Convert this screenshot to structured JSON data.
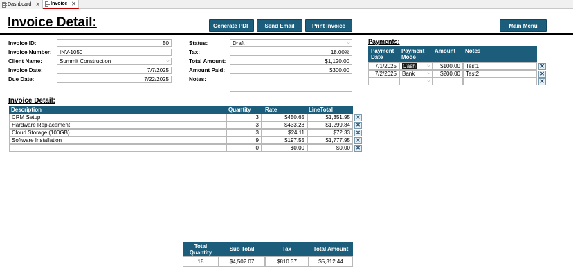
{
  "tabs": [
    {
      "label": "Dashboard",
      "active": false
    },
    {
      "label": "Invoice",
      "active": true
    }
  ],
  "title": "Invoice Detail:",
  "buttons": {
    "generate_pdf": "Generate PDF",
    "send_email": "Send Email",
    "print_invoice": "Print Invoice",
    "main_menu": "Main Menu"
  },
  "fields_left": {
    "invoice_id": {
      "label": "Invoice ID:",
      "value": "50"
    },
    "invoice_number": {
      "label": "Invoice Number:",
      "value": "INV-1050"
    },
    "client_name": {
      "label": "Client Name:",
      "value": "Summit Construction"
    },
    "invoice_date": {
      "label": "Invoice Date:",
      "value": "7/7/2025"
    },
    "due_date": {
      "label": "Due Date:",
      "value": "7/22/2025"
    }
  },
  "fields_mid": {
    "status": {
      "label": "Status:",
      "value": "Draft"
    },
    "tax": {
      "label": "Tax:",
      "value": "18.00%"
    },
    "total_amount": {
      "label": "Total Amount:",
      "value": "$1,120.00"
    },
    "amount_paid": {
      "label": "Amount Paid:",
      "value": "$300.00"
    },
    "notes": {
      "label": "Notes:",
      "value": ""
    }
  },
  "payments": {
    "title": "Payments:",
    "headers": {
      "date": "Payment Date",
      "mode": "Payment Mode",
      "amount": "Amount",
      "notes": "Notes"
    },
    "rows": [
      {
        "date": "7/1/2025",
        "mode": "Cash",
        "amount": "$100.00",
        "notes": "Test1"
      },
      {
        "date": "7/2/2025",
        "mode": "Bank",
        "amount": "$200.00",
        "notes": "Test2"
      },
      {
        "date": "",
        "mode": "",
        "amount": "",
        "notes": ""
      }
    ]
  },
  "detail": {
    "title": "Invoice Detail:",
    "headers": {
      "description": "Description",
      "quantity": "Quantity",
      "rate": "Rate",
      "line_total": "LineTotal"
    },
    "rows": [
      {
        "description": "CRM Setup",
        "quantity": "3",
        "rate": "$450.65",
        "line_total": "$1,351.95"
      },
      {
        "description": "Hardware Replacement",
        "quantity": "3",
        "rate": "$433.28",
        "line_total": "$1,299.84"
      },
      {
        "description": "Cloud Storage (100GB)",
        "quantity": "3",
        "rate": "$24.11",
        "line_total": "$72.33"
      },
      {
        "description": "Software Installation",
        "quantity": "9",
        "rate": "$197.55",
        "line_total": "$1,777.95"
      },
      {
        "description": "",
        "quantity": "0",
        "rate": "$0.00",
        "line_total": "$0.00"
      }
    ]
  },
  "totals": {
    "headers": {
      "quantity": "Total Quantity",
      "sub_total": "Sub Total",
      "tax": "Tax",
      "total_amount": "Total Amount"
    },
    "values": {
      "quantity": "18",
      "sub_total": "$4,502.07",
      "tax": "$810.37",
      "total_amount": "$5,312.44"
    }
  },
  "icons": {
    "delete": "close-icon",
    "dropdown": "chevron-down-icon",
    "tab": "form-icon"
  },
  "colors": {
    "header": "#1b5d7a",
    "active_tab_accent": "#c00000"
  }
}
